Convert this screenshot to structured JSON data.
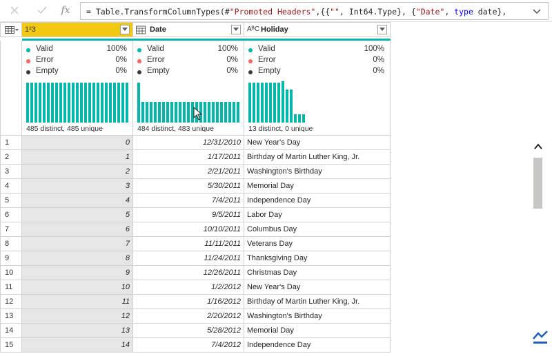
{
  "formula": {
    "cancel_icon": "close-icon",
    "commit_icon": "check-icon",
    "fx_label": "fx",
    "prefix": "= Table.TransformColumnTypes(#",
    "s1": "\"Promoted Headers\"",
    "mid1": ",{{",
    "s2": "\"\"",
    "mid2": ", Int64.Type}, {",
    "s3": "\"Date\"",
    "mid3": ", ",
    "kw": "type",
    "mid4": " date},"
  },
  "columns": [
    {
      "type_label": "1²3",
      "name": "",
      "selected": true
    },
    {
      "type_label": "calendar-icon",
      "name": "Date"
    },
    {
      "type_label": "AᴮC",
      "name": "Holiday"
    }
  ],
  "profiles": [
    {
      "valid": "Valid",
      "valid_pct": "100%",
      "error": "Error",
      "error_pct": "0%",
      "empty": "Empty",
      "empty_pct": "0%",
      "distinct": "485 distinct, 485 unique"
    },
    {
      "valid": "Valid",
      "valid_pct": "100%",
      "error": "Error",
      "error_pct": "0%",
      "empty": "Empty",
      "empty_pct": "0%",
      "distinct": "484 distinct, 483 unique"
    },
    {
      "valid": "Valid",
      "valid_pct": "100%",
      "error": "Error",
      "error_pct": "0%",
      "empty": "Empty",
      "empty_pct": "0%",
      "distinct": "13 distinct, 0 unique"
    }
  ],
  "colors": {
    "valid": "#01b8aa",
    "error": "#fd625e",
    "empty": "#3b3a39",
    "accent": "#f2c811"
  },
  "rows": [
    {
      "n": "1",
      "idx": "0",
      "date": "12/31/2010",
      "holiday": "New Year's Day"
    },
    {
      "n": "2",
      "idx": "1",
      "date": "1/17/2011",
      "holiday": "Birthday of Martin Luther King, Jr."
    },
    {
      "n": "3",
      "idx": "2",
      "date": "2/21/2011",
      "holiday": "Washington's Birthday"
    },
    {
      "n": "4",
      "idx": "3",
      "date": "5/30/2011",
      "holiday": "Memorial Day"
    },
    {
      "n": "5",
      "idx": "4",
      "date": "7/4/2011",
      "holiday": "Independence Day"
    },
    {
      "n": "6",
      "idx": "5",
      "date": "9/5/2011",
      "holiday": "Labor Day"
    },
    {
      "n": "7",
      "idx": "6",
      "date": "10/10/2011",
      "holiday": "Columbus Day"
    },
    {
      "n": "8",
      "idx": "7",
      "date": "11/11/2011",
      "holiday": "Veterans Day"
    },
    {
      "n": "9",
      "idx": "8",
      "date": "11/24/2011",
      "holiday": "Thanksgiving Day"
    },
    {
      "n": "10",
      "idx": "9",
      "date": "12/26/2011",
      "holiday": "Christmas Day"
    },
    {
      "n": "11",
      "idx": "10",
      "date": "1/2/2012",
      "holiday": "New Year's Day"
    },
    {
      "n": "12",
      "idx": "11",
      "date": "1/16/2012",
      "holiday": "Birthday of Martin Luther King, Jr."
    },
    {
      "n": "13",
      "idx": "12",
      "date": "2/20/2012",
      "holiday": "Washington's Birthday"
    },
    {
      "n": "14",
      "idx": "13",
      "date": "5/28/2012",
      "holiday": "Memorial Day"
    },
    {
      "n": "15",
      "idx": "14",
      "date": "7/4/2012",
      "holiday": "Independence Day"
    }
  ]
}
